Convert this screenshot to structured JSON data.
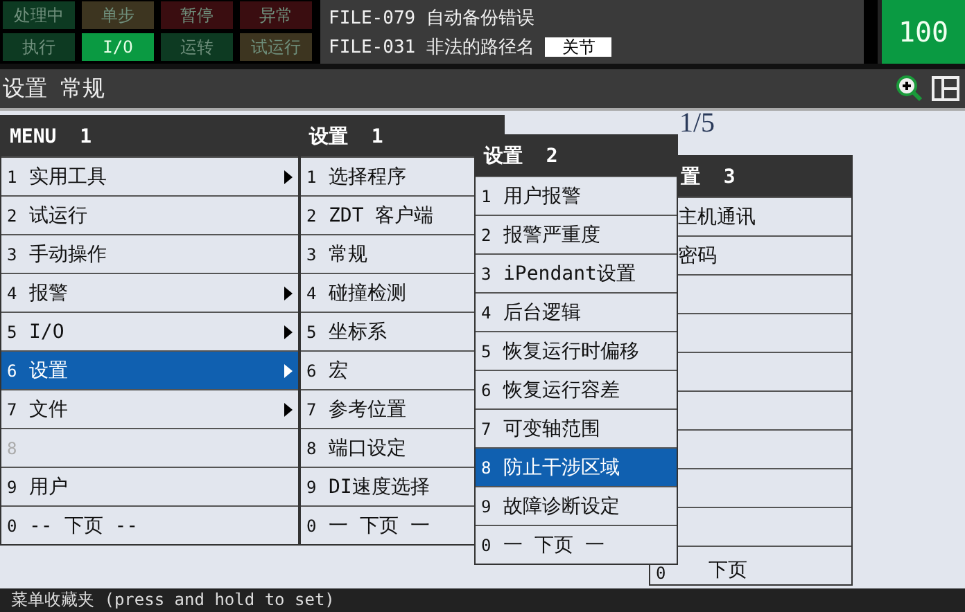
{
  "status_buttons": [
    {
      "label": "处理中",
      "color": "#0d3a22",
      "on": false
    },
    {
      "label": "单步",
      "color": "#3d3520",
      "on": false
    },
    {
      "label": "暂停",
      "color": "#3a0d10",
      "on": false
    },
    {
      "label": "异常",
      "color": "#3a0d10",
      "on": false
    },
    {
      "label": "执行",
      "color": "#0d3a22",
      "on": false
    },
    {
      "label": "I/O",
      "color": "#0a9a42",
      "on": true
    },
    {
      "label": "运转",
      "color": "#0d3a22",
      "on": false
    },
    {
      "label": "试运行",
      "color": "#3d3520",
      "on": false
    }
  ],
  "messages": [
    {
      "text": "FILE-079 自动备份错误"
    },
    {
      "text": "FILE-031 非法的路径名",
      "badge": "关节"
    }
  ],
  "override": "100",
  "screen_title": "设置 常规",
  "page_indicator": "1/5",
  "menus": [
    {
      "title": "MENU  1",
      "items": [
        {
          "number": "1",
          "text": "实用工具",
          "submenu": true,
          "selected": false,
          "disabled": false
        },
        {
          "number": "2",
          "text": "试运行",
          "submenu": false,
          "selected": false,
          "disabled": false
        },
        {
          "number": "3",
          "text": "手动操作",
          "submenu": false,
          "selected": false,
          "disabled": false
        },
        {
          "number": "4",
          "text": "报警",
          "submenu": true,
          "selected": false,
          "disabled": false
        },
        {
          "number": "5",
          "text": "I/O",
          "submenu": true,
          "selected": false,
          "disabled": false
        },
        {
          "number": "6",
          "text": "设置",
          "submenu": true,
          "selected": true,
          "disabled": false
        },
        {
          "number": "7",
          "text": "文件",
          "submenu": true,
          "selected": false,
          "disabled": false
        },
        {
          "number": "8",
          "submenu": false,
          "selected": false,
          "disabled": true
        },
        {
          "number": "9",
          "text": "用户",
          "submenu": false,
          "selected": false,
          "disabled": false
        },
        {
          "number": "0",
          "text": "-- 下页 --",
          "submenu": false,
          "selected": false,
          "disabled": false
        }
      ]
    },
    {
      "title": "设置  1",
      "items": [
        {
          "number": "1",
          "text": "选择程序",
          "selected": false
        },
        {
          "number": "2",
          "text": "ZDT 客户端",
          "selected": false
        },
        {
          "number": "3",
          "text": "常规",
          "selected": false
        },
        {
          "number": "4",
          "text": "碰撞检测",
          "selected": false
        },
        {
          "number": "5",
          "text": "坐标系",
          "selected": false
        },
        {
          "number": "6",
          "text": "宏",
          "selected": false
        },
        {
          "number": "7",
          "text": "参考位置",
          "selected": false
        },
        {
          "number": "8",
          "text": "端口设定",
          "selected": false
        },
        {
          "number": "9",
          "text": "DI速度选择",
          "selected": false
        },
        {
          "number": "0",
          "text": "一 下页 一",
          "selected": false
        }
      ]
    },
    {
      "title": "设置  2",
      "items": [
        {
          "number": "1",
          "text": "用户报警",
          "selected": false
        },
        {
          "number": "2",
          "text": "报警严重度",
          "selected": false
        },
        {
          "number": "3",
          "text": "iPendant设置",
          "selected": false
        },
        {
          "number": "4",
          "text": "后台逻辑",
          "selected": false
        },
        {
          "number": "5",
          "text": "恢复运行时偏移",
          "selected": false
        },
        {
          "number": "6",
          "text": "恢复运行容差",
          "selected": false
        },
        {
          "number": "7",
          "text": "可变轴范围",
          "selected": false
        },
        {
          "number": "8",
          "text": "防止干涉区域",
          "selected": true
        },
        {
          "number": "9",
          "text": "故障诊断设定",
          "selected": false
        },
        {
          "number": "0",
          "text": "一 下页 一",
          "selected": false
        }
      ]
    },
    {
      "title": "置  3",
      "items": [
        {
          "text": "主机通讯",
          "selected": false
        },
        {
          "text": "密码",
          "selected": false
        },
        {
          "selected": false
        },
        {
          "selected": false
        },
        {
          "selected": false
        },
        {
          "selected": false
        },
        {
          "selected": false
        },
        {
          "selected": false
        },
        {
          "selected": false
        },
        {
          "number": "0",
          "text": "下页",
          "selected": false
        }
      ]
    }
  ],
  "bottom_bar": "菜单收藏夹 (press and hold to set)"
}
